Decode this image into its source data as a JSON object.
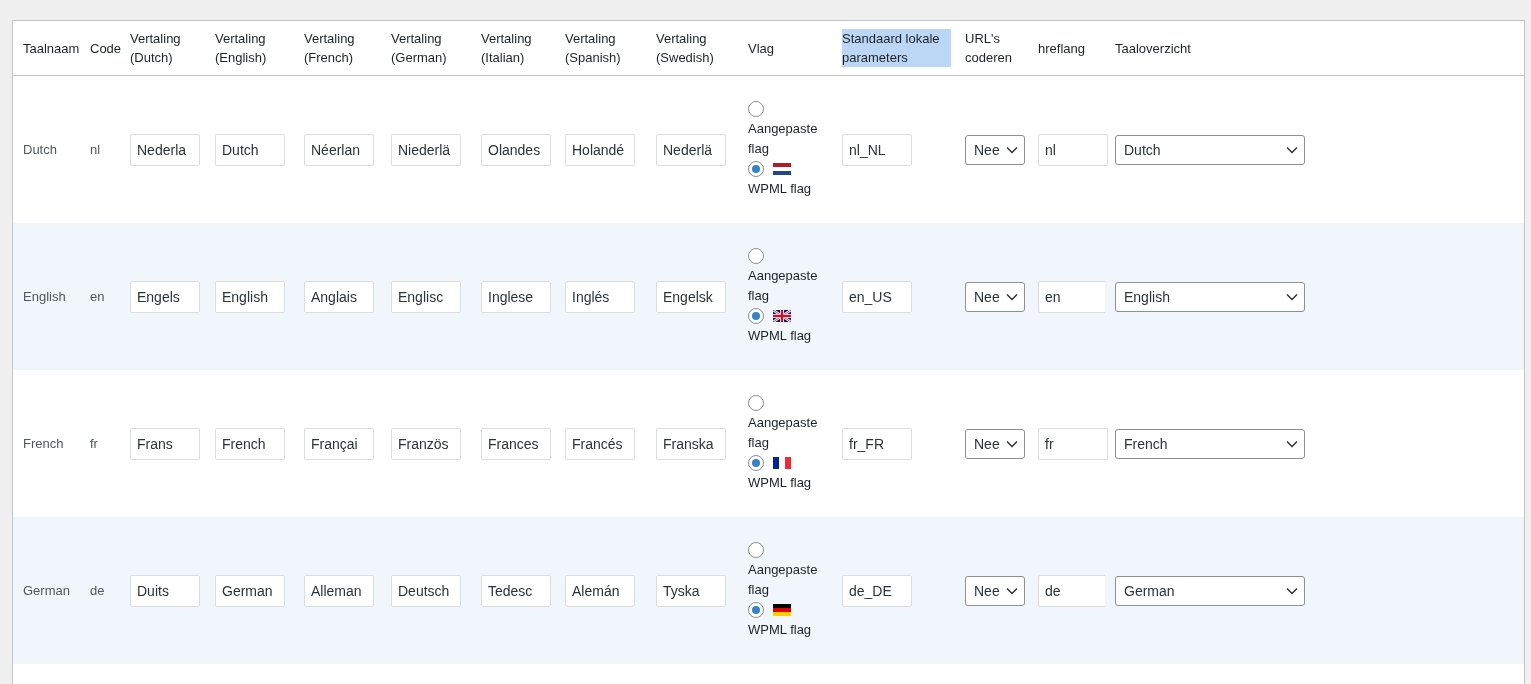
{
  "table": {
    "columns": [
      {
        "label": "Taalnaam",
        "highlighted": false
      },
      {
        "label": "Code",
        "highlighted": false
      },
      {
        "label": "Vertaling (Dutch)",
        "highlighted": false
      },
      {
        "label": "Vertaling (English)",
        "highlighted": false
      },
      {
        "label": "Vertaling (French)",
        "highlighted": false
      },
      {
        "label": "Vertaling (German)",
        "highlighted": false
      },
      {
        "label": "Vertaling (Italian)",
        "highlighted": false
      },
      {
        "label": "Vertaling (Spanish)",
        "highlighted": false
      },
      {
        "label": "Vertaling (Swedish)",
        "highlighted": false
      },
      {
        "label": "Vlag",
        "highlighted": false
      },
      {
        "label": "Standaard lokale parameters",
        "highlighted": true
      },
      {
        "label": "URL's coderen",
        "highlighted": false
      },
      {
        "label": "hreflang",
        "highlighted": false
      },
      {
        "label": "Taaloverzicht",
        "highlighted": false
      }
    ],
    "rows": [
      {
        "name": "Dutch",
        "code": "nl",
        "translations": [
          "Nederla",
          "Dutch",
          "Néerlan",
          "Niederlä",
          "Olandes",
          "Holandé",
          "Nederlä"
        ],
        "flag_options": [
          {
            "label": "Aangepaste flag",
            "selected": false
          },
          {
            "label": "WPML flag",
            "selected": true
          }
        ],
        "flag": {
          "kind": "nl"
        },
        "locale": "nl_NL",
        "encode_urls": "Nee",
        "hreflang": "nl",
        "overview": "Dutch"
      },
      {
        "name": "English",
        "code": "en",
        "translations": [
          "Engels",
          "English",
          "Anglais",
          "Englisc",
          "Inglese",
          "Inglés",
          "Engelsk"
        ],
        "flag_options": [
          {
            "label": "Aangepaste flag",
            "selected": false
          },
          {
            "label": "WPML flag",
            "selected": true
          }
        ],
        "flag": {
          "kind": "gb"
        },
        "locale": "en_US",
        "encode_urls": "Nee",
        "hreflang": "en",
        "overview": "English"
      },
      {
        "name": "French",
        "code": "fr",
        "translations": [
          "Frans",
          "French",
          "Françai",
          "Französ",
          "Frances",
          "Francés",
          "Franska"
        ],
        "flag_options": [
          {
            "label": "Aangepaste flag",
            "selected": false
          },
          {
            "label": "WPML flag",
            "selected": true
          }
        ],
        "flag": {
          "kind": "fr"
        },
        "locale": "fr_FR",
        "encode_urls": "Nee",
        "hreflang": "fr",
        "overview": "French"
      },
      {
        "name": "German",
        "code": "de",
        "translations": [
          "Duits",
          "German",
          "Alleman",
          "Deutsch",
          "Tedesc",
          "Alemán",
          "Tyska"
        ],
        "flag_options": [
          {
            "label": "Aangepaste flag",
            "selected": false
          },
          {
            "label": "WPML flag",
            "selected": true
          }
        ],
        "flag": {
          "kind": "de"
        },
        "locale": "de_DE",
        "encode_urls": "Nee",
        "hreflang": "de",
        "overview": "German"
      }
    ]
  }
}
